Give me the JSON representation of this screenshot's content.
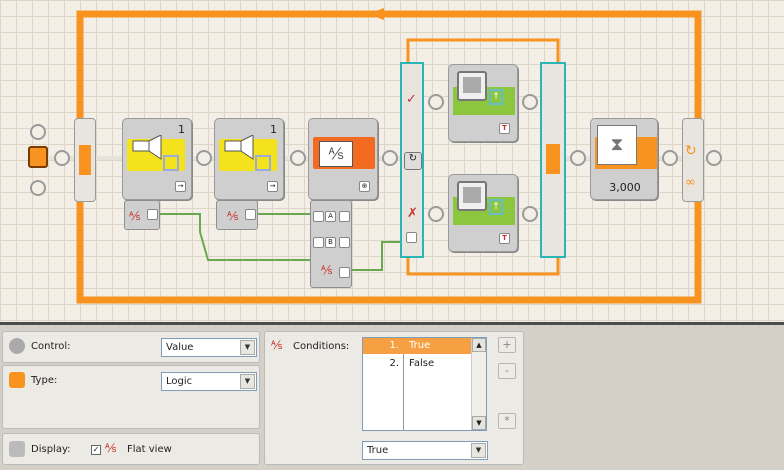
{
  "canvas": {
    "sound_block_1_number": "1",
    "sound_block_2_number": "1",
    "wait_block_value": "3,000",
    "compare_plug_a": "A",
    "compare_plug_b": "B",
    "colors": {
      "loop": "#f7931e",
      "switch_border": "#2bb5b5",
      "sound": "#f3e21c",
      "display": "#8cc63f",
      "logic": "#f26b21"
    }
  },
  "panel": {
    "control_label": "Control:",
    "control_value": "Value",
    "type_label": "Type:",
    "type_value": "Logic",
    "display_label": "Display:",
    "flat_view_label": "Flat view",
    "flat_view_checked": true,
    "conditions_label": "Conditions:",
    "conditions": [
      {
        "index": "1.",
        "value": "True",
        "selected": true
      },
      {
        "index": "2.",
        "value": "False",
        "selected": false
      }
    ],
    "condition_select_value": "True",
    "add_label": "+",
    "remove_label": "-",
    "default_label": "*"
  }
}
